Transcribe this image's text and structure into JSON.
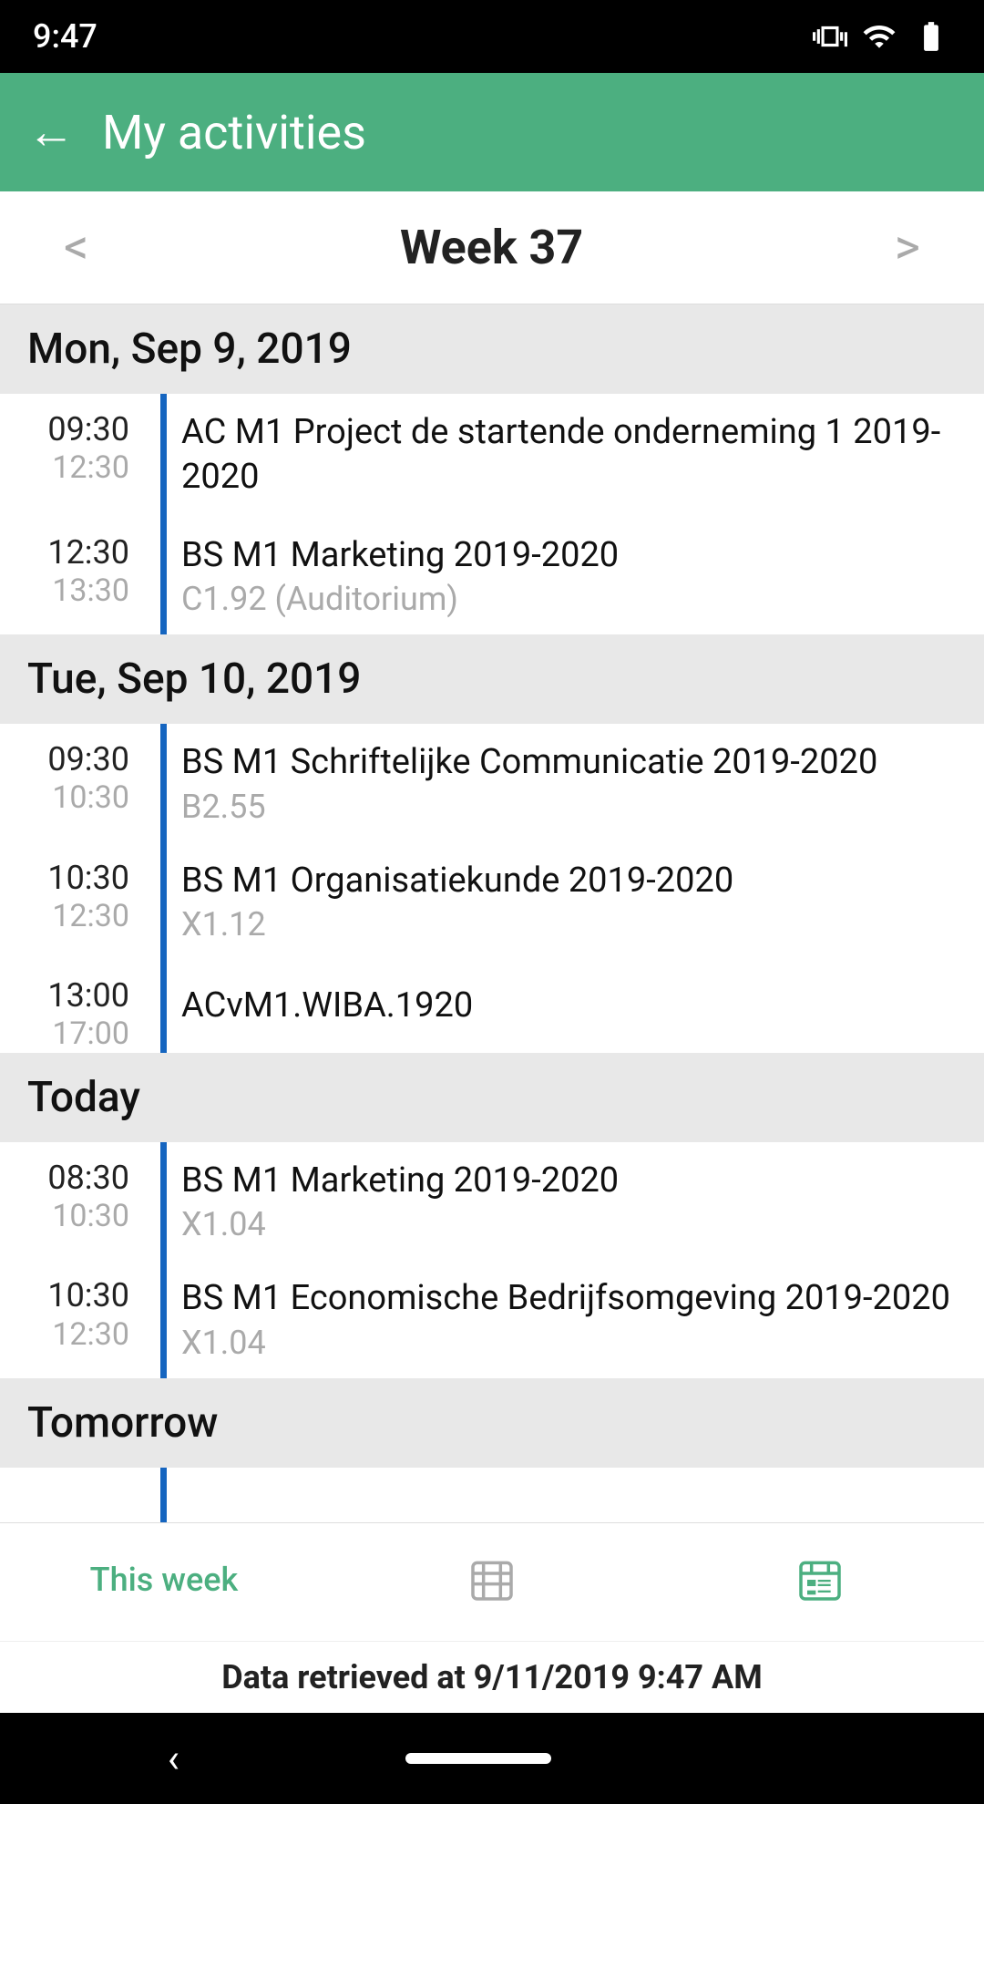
{
  "statusBar": {
    "time": "9:47"
  },
  "appBar": {
    "title": "My activities",
    "backLabel": "←"
  },
  "weekNav": {
    "title": "Week 37",
    "prevArrow": "<",
    "nextArrow": ">"
  },
  "days": [
    {
      "label": "Mon, Sep 9, 2019",
      "entries": [
        {
          "startTime": "09:30",
          "endTime": "12:30",
          "title": "AC M1 Project de startende onderneming 1 2019-2020",
          "subtitle": ""
        },
        {
          "startTime": "12:30",
          "endTime": "13:30",
          "title": "BS M1 Marketing 2019-2020",
          "subtitle": "C1.92 (Auditorium)"
        }
      ]
    },
    {
      "label": "Tue, Sep 10, 2019",
      "entries": [
        {
          "startTime": "09:30",
          "endTime": "10:30",
          "title": "BS M1 Schriftelijke Communicatie 2019-2020",
          "subtitle": "B2.55"
        },
        {
          "startTime": "10:30",
          "endTime": "12:30",
          "title": "BS M1 Organisatiekunde 2019-2020",
          "subtitle": "X1.12"
        },
        {
          "startTime": "13:00",
          "endTime": "17:00",
          "title": "ACvM1.WIBA.1920",
          "subtitle": ""
        }
      ]
    },
    {
      "label": "Today",
      "entries": [
        {
          "startTime": "08:30",
          "endTime": "10:30",
          "title": "BS M1 Marketing 2019-2020",
          "subtitle": "X1.04"
        },
        {
          "startTime": "10:30",
          "endTime": "12:30",
          "title": "BS M1 Economische Bedrijfsomgeving 2019-2020",
          "subtitle": "X1.04"
        }
      ]
    },
    {
      "label": "Tomorrow",
      "entries": []
    }
  ],
  "bottomTabs": [
    {
      "label": "This week",
      "icon": "calendar-week",
      "active": true
    },
    {
      "label": "",
      "icon": "calendar-grid",
      "active": false
    },
    {
      "label": "",
      "icon": "calendar-agenda",
      "active": false
    }
  ],
  "dataBar": {
    "text": "Data retrieved at 9/11/2019 9:47 AM"
  }
}
